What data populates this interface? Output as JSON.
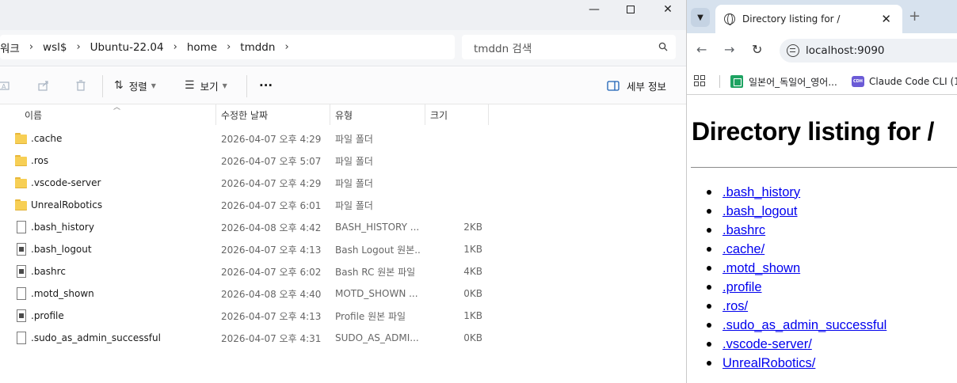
{
  "explorer": {
    "window_controls": {
      "minimize": "—",
      "maximize": "",
      "close": "✕"
    },
    "breadcrumbs": [
      "워크",
      "wsl$",
      "Ubuntu-22.04",
      "home",
      "tmddn"
    ],
    "breadcrumb_sep": "›",
    "search_placeholder": "tmddn 검색",
    "toolbar": {
      "sort_label": "정렬",
      "view_label": "보기",
      "more_label": "···",
      "details_label": "세부 정보"
    },
    "columns": {
      "name": "이름",
      "date": "수정한 날짜",
      "type": "유형",
      "size": "크기"
    },
    "files": [
      {
        "name": ".cache",
        "date": "2026-04-07 오후 4:29",
        "type": "파일 폴더",
        "size": "",
        "icon": "folder"
      },
      {
        "name": ".ros",
        "date": "2026-04-07 오후 5:07",
        "type": "파일 폴더",
        "size": "",
        "icon": "folder"
      },
      {
        "name": ".vscode-server",
        "date": "2026-04-07 오후 4:29",
        "type": "파일 폴더",
        "size": "",
        "icon": "folder"
      },
      {
        "name": "UnrealRobotics",
        "date": "2026-04-07 오후 6:01",
        "type": "파일 폴더",
        "size": "",
        "icon": "folder"
      },
      {
        "name": ".bash_history",
        "date": "2026-04-08 오후 4:42",
        "type": "BASH_HISTORY ...",
        "size": "2KB",
        "icon": "doc"
      },
      {
        "name": ".bash_logout",
        "date": "2026-04-07 오후 4:13",
        "type": "Bash Logout 원본...",
        "size": "1KB",
        "icon": "doc-dark"
      },
      {
        "name": ".bashrc",
        "date": "2026-04-07 오후 6:02",
        "type": "Bash RC 원본 파일",
        "size": "4KB",
        "icon": "doc-dark"
      },
      {
        "name": ".motd_shown",
        "date": "2026-04-08 오후 4:40",
        "type": "MOTD_SHOWN ...",
        "size": "0KB",
        "icon": "doc"
      },
      {
        "name": ".profile",
        "date": "2026-04-07 오후 4:13",
        "type": "Profile 원본 파일",
        "size": "1KB",
        "icon": "doc-dark"
      },
      {
        "name": ".sudo_as_admin_successful",
        "date": "2026-04-07 오후 4:31",
        "type": "SUDO_AS_ADMI...",
        "size": "0KB",
        "icon": "doc"
      }
    ]
  },
  "browser": {
    "tab_title": "Directory listing for /",
    "url": "localhost:9090",
    "bookmarks": [
      "일본어_독일어_영어...",
      "Claude Code CLI (1..."
    ],
    "cdh_badge": "CDH",
    "page_heading": "Directory listing for /",
    "links": [
      ".bash_history",
      ".bash_logout",
      ".bashrc",
      ".cache/",
      ".motd_shown",
      ".profile",
      ".ros/",
      ".sudo_as_admin_successful",
      ".vscode-server/",
      "UnrealRobotics/"
    ]
  },
  "colors": {
    "folder": "#f7cf55",
    "link": "#0000ee",
    "tabstrip": "#d7e2ee",
    "sheets": "#1ea362",
    "cdh": "#6b5bd6"
  }
}
